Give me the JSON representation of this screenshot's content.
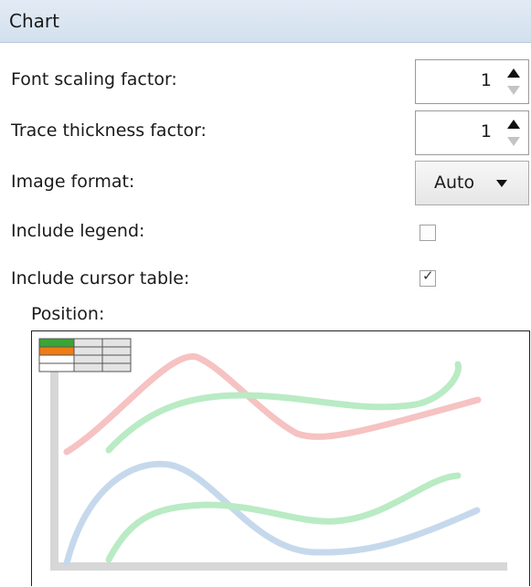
{
  "section": {
    "title": "Chart"
  },
  "settings": {
    "font_scaling": {
      "label": "Font scaling factor:",
      "value": "1"
    },
    "trace_thickness": {
      "label": "Trace thickness factor:",
      "value": "1"
    },
    "image_format": {
      "label": "Image format:",
      "selected": "Auto"
    },
    "include_legend": {
      "label": "Include legend:",
      "checked": false
    },
    "include_cursor_table": {
      "label": "Include cursor table:",
      "checked": true,
      "check_glyph": "✓"
    }
  },
  "position": {
    "label": "Position:",
    "selected_corner": "top-left"
  },
  "colors": {
    "header_bg": "#d3e0ee",
    "trace_red": "#f6c2c2",
    "trace_green": "#b9ebc4",
    "trace_blue": "#c6d9ec",
    "table_green": "#3aa535",
    "table_orange": "#f07c14"
  }
}
